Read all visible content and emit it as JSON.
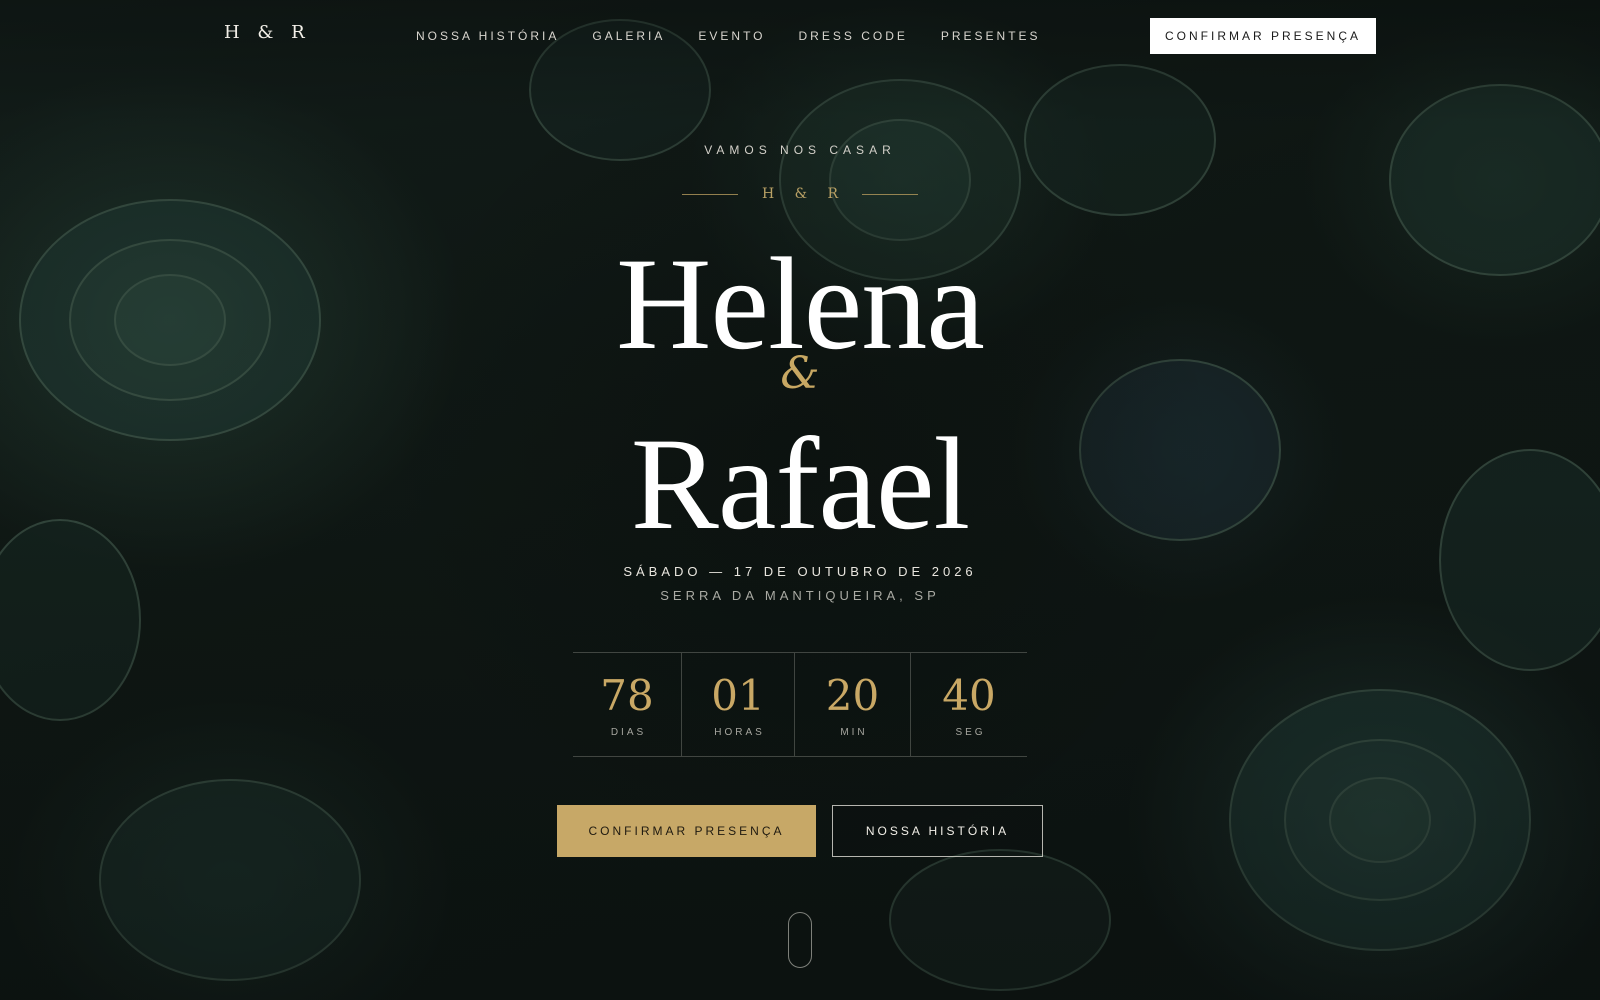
{
  "nav": {
    "logo": "H & R",
    "links": [
      "NOSSA HISTÓRIA",
      "GALERIA",
      "EVENTO",
      "DRESS CODE",
      "PRESENTES"
    ],
    "cta_label": "CONFIRMAR PRESENÇA"
  },
  "hero": {
    "eyebrow": "VAMOS NOS CASAR",
    "monogram": "H & R",
    "name_1": "Helena",
    "ampersand": "&",
    "name_2": "Rafael",
    "date": "SÁBADO — 17 DE OUTUBRO DE 2026",
    "place": "SERRA DA MANTIQUEIRA, SP"
  },
  "countdown": [
    {
      "value": "78",
      "label": "DIAS"
    },
    {
      "value": "01",
      "label": "HORAS"
    },
    {
      "value": "20",
      "label": "MIN"
    },
    {
      "value": "40",
      "label": "SEG"
    }
  ],
  "actions": {
    "primary_label": "CONFIRMAR PRESENÇA",
    "secondary_label": "NOSSA HISTÓRIA"
  },
  "colors": {
    "accent_gold": "#c7a867",
    "text_light": "#ffffff",
    "background_dark": "#0d1512"
  },
  "icons": {
    "scroll": "scroll-mouse-icon"
  }
}
